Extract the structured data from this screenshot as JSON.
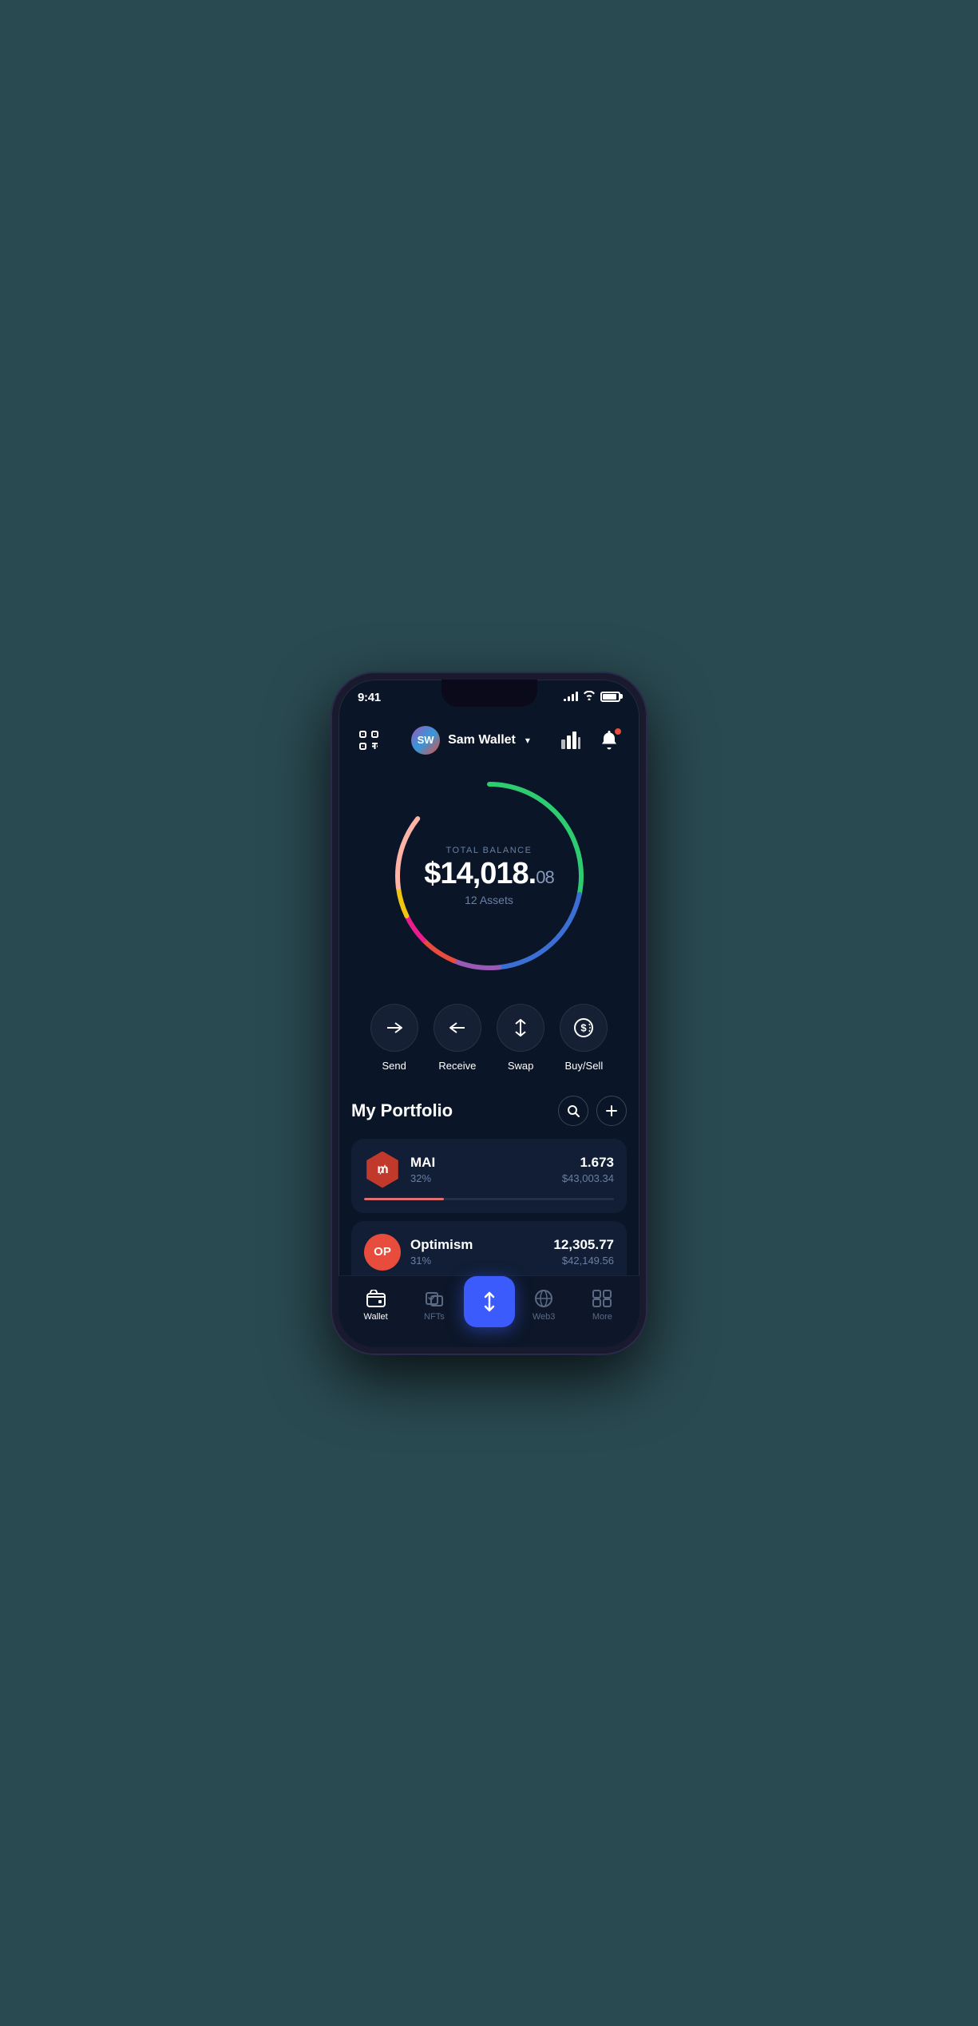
{
  "status": {
    "time": "9:41",
    "signal_bars": [
      3,
      6,
      9,
      12
    ],
    "battery_pct": 90
  },
  "header": {
    "scan_label": "scan",
    "wallet_initials": "SW",
    "wallet_name": "Sam Wallet",
    "chevron": "▾",
    "chart_label": "chart",
    "notif_label": "notifications"
  },
  "balance": {
    "label": "TOTAL BALANCE",
    "main": "$14,018.",
    "cents": "08",
    "assets": "12 Assets"
  },
  "actions": [
    {
      "id": "send",
      "label": "Send"
    },
    {
      "id": "receive",
      "label": "Receive"
    },
    {
      "id": "swap",
      "label": "Swap"
    },
    {
      "id": "buysell",
      "label": "Buy/Sell"
    }
  ],
  "portfolio": {
    "title": "My Portfolio",
    "search_label": "search",
    "add_label": "add"
  },
  "assets": [
    {
      "id": "mai",
      "symbol": "M",
      "name": "MAI",
      "pct": "32%",
      "amount": "1.673",
      "usd": "$43,003.34",
      "fill_width": "32",
      "fill_color": "#e07070",
      "icon_bg": "#c0392b"
    },
    {
      "id": "op",
      "symbol": "OP",
      "name": "Optimism",
      "pct": "31%",
      "amount": "12,305.77",
      "usd": "$42,149.56",
      "fill_width": "31",
      "fill_color": "#e74c3c",
      "icon_bg": "#e74c3c"
    }
  ],
  "nav": [
    {
      "id": "wallet",
      "label": "Wallet",
      "active": true
    },
    {
      "id": "nfts",
      "label": "NFTs",
      "active": false
    },
    {
      "id": "center",
      "label": "",
      "active": false
    },
    {
      "id": "web3",
      "label": "Web3",
      "active": false
    },
    {
      "id": "more",
      "label": "More",
      "active": false
    }
  ],
  "circle": {
    "segments": [
      {
        "color": "#2ecc71",
        "start": 0,
        "end": 0.28
      },
      {
        "color": "#3498db",
        "start": 0.28,
        "end": 0.55
      },
      {
        "color": "#9b59b6",
        "start": 0.55,
        "end": 0.64
      },
      {
        "color": "#e74c3c",
        "start": 0.64,
        "end": 0.72
      },
      {
        "color": "#e91e8c",
        "start": 0.72,
        "end": 0.78
      },
      {
        "color": "#f1c40f",
        "start": 0.78,
        "end": 0.84
      },
      {
        "color": "#ffb3a7",
        "start": 0.84,
        "end": 0.97
      }
    ]
  }
}
